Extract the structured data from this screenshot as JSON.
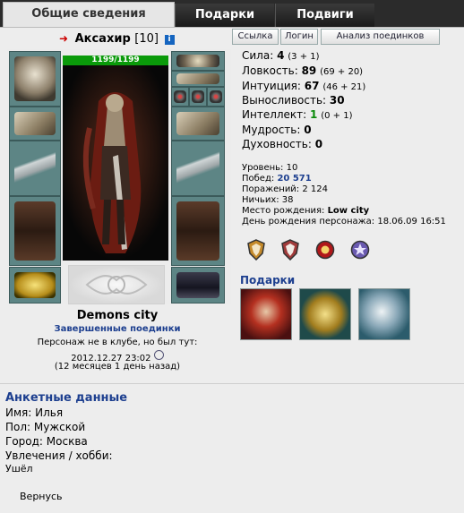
{
  "tabs": [
    {
      "label": "Общие сведения",
      "active": true
    },
    {
      "label": "Подарки",
      "active": false
    },
    {
      "label": "Подвиги",
      "active": false
    }
  ],
  "character": {
    "name": "Аксахир",
    "level": "[10]",
    "info_icon": "i",
    "hp": "1199/1199",
    "hp_fraction": 1.0
  },
  "buttons": {
    "link": "Ссылка",
    "login": "Логин",
    "duel_analysis": "Анализ поединков"
  },
  "equipment": [
    {
      "slot": "helmet",
      "icon": "helmet-icon"
    },
    {
      "slot": "bracers",
      "icon": "bracers-icon"
    },
    {
      "slot": "left-weapon",
      "icon": "sword-icon"
    },
    {
      "slot": "leggings-left",
      "icon": "gloves-icon"
    },
    {
      "slot": "belt",
      "icon": "belt-icon"
    },
    {
      "slot": "amulet",
      "icon": "amulet-icon"
    },
    {
      "slot": "rings",
      "icon": "ring-icon"
    },
    {
      "slot": "gloves",
      "icon": "gauntlet-icon"
    },
    {
      "slot": "right-weapon",
      "icon": "sword-icon"
    },
    {
      "slot": "legs",
      "icon": "pants-icon"
    },
    {
      "slot": "boots",
      "icon": "boots-icon"
    }
  ],
  "location": {
    "city": "Demons city",
    "duels_link": "Завершенные поединки",
    "not_in_club": "Персонаж не в клубе, но был тут:",
    "last_seen": "2012.12.27 23:02",
    "ago": "(12 месяцев 1 день назад)"
  },
  "stats": [
    {
      "label": "Сила:",
      "value": "4",
      "bonus": "(3 + 1)",
      "green": false
    },
    {
      "label": "Ловкость:",
      "value": "89",
      "bonus": "(69 + 20)",
      "green": false
    },
    {
      "label": "Интуиция:",
      "value": "67",
      "bonus": "(46 + 21)",
      "green": false
    },
    {
      "label": "Выносливость:",
      "value": "30",
      "bonus": "",
      "green": false
    },
    {
      "label": "Интеллект:",
      "value": "1",
      "bonus": "(0 + 1)",
      "green": true
    },
    {
      "label": "Мудрость:",
      "value": "0",
      "bonus": "",
      "green": false
    },
    {
      "label": "Духовность:",
      "value": "0",
      "bonus": "",
      "green": false
    }
  ],
  "info": {
    "level_label": "Уровень:",
    "level": "10",
    "wins_label": "Побед:",
    "wins": "20 571",
    "losses_label": "Поражений:",
    "losses": "2 124",
    "draws_label": "Ничьих:",
    "draws": "38",
    "birthplace_label": "Место рождения:",
    "birthplace": "Low city",
    "birthday_label": "День рождения персонажа:",
    "birthday": "18.06.09 16:51"
  },
  "achievement_icons": [
    "shield-badge-icon",
    "shield-badge-icon",
    "rose-badge-icon",
    "star-badge-icon"
  ],
  "achievement_colors": [
    "#c58a2a",
    "#a03a3a",
    "#b0181a",
    "#6a5ab0"
  ],
  "gifts": {
    "title": "Подарки",
    "items": [
      "gift-warrior-icon",
      "gift-wings-emblem-icon",
      "gift-shield-icon"
    ]
  },
  "profile": {
    "title": "Анкетные данные",
    "name_label": "Имя:",
    "name": "Илья",
    "gender_label": "Пол:",
    "gender": "Мужской",
    "city_label": "Город:",
    "city": "Москва",
    "hobby_label": "Увлечения / хобби:",
    "hobby": "Ушёл",
    "extra": "Вернусь"
  },
  "colors": {
    "link_blue": "#1d3f8f",
    "hp_green": "#0a9a0a",
    "stat_green": "#0a8a0a",
    "tab_dark": "#2b2b2b"
  }
}
